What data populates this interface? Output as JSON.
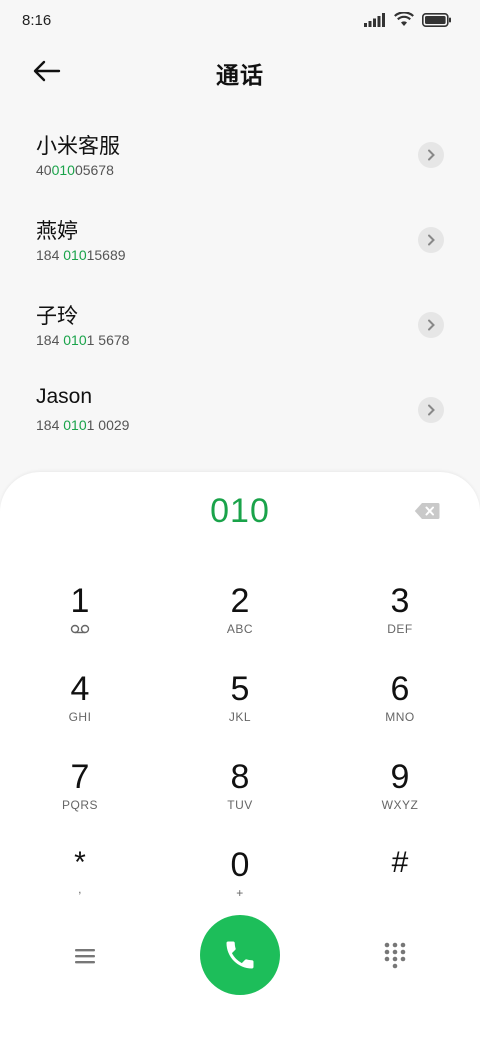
{
  "status_bar": {
    "time": "8:16"
  },
  "header": {
    "title": "通话"
  },
  "contacts": [
    {
      "name": "小米客服",
      "number_pre": "40",
      "number_match": "010",
      "number_post": "05678"
    },
    {
      "name": "燕婷",
      "number_pre": "184 ",
      "number_match": "010",
      "number_post": "15689"
    },
    {
      "name": "子玲",
      "number_pre": "184 ",
      "number_match": "010",
      "number_post": "1 5678"
    },
    {
      "name": "Jason",
      "number_pre": "184 ",
      "number_match": "010",
      "number_post": "1 0029"
    }
  ],
  "dialpad": {
    "input": "010",
    "keys": [
      {
        "digit": "1",
        "sub": ""
      },
      {
        "digit": "2",
        "sub": "ABC"
      },
      {
        "digit": "3",
        "sub": "DEF"
      },
      {
        "digit": "4",
        "sub": "GHI"
      },
      {
        "digit": "5",
        "sub": "JKL"
      },
      {
        "digit": "6",
        "sub": "MNO"
      },
      {
        "digit": "7",
        "sub": "PQRS"
      },
      {
        "digit": "8",
        "sub": "TUV"
      },
      {
        "digit": "9",
        "sub": "WXYZ"
      },
      {
        "digit": "*",
        "sub": ","
      },
      {
        "digit": "0",
        "sub": "+"
      },
      {
        "digit": "#",
        "sub": ""
      }
    ]
  },
  "icons": {
    "back": "arrow-left-icon",
    "chevron": "chevron-right-icon",
    "backspace": "backspace-icon",
    "voicemail": "voicemail-icon",
    "menu": "menu-icon",
    "call": "phone-icon",
    "keypad": "keypad-icon"
  },
  "colors": {
    "accent": "#1aa34a",
    "call_button": "#1dbe5a"
  }
}
